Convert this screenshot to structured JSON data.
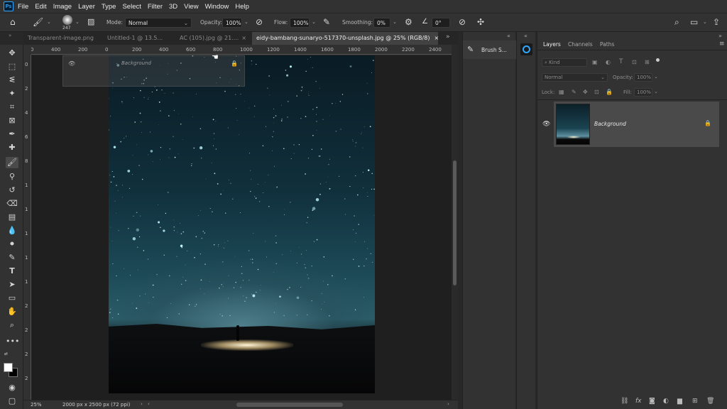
{
  "app": {
    "logo_text": "Ps"
  },
  "menu": [
    "File",
    "Edit",
    "Image",
    "Layer",
    "Type",
    "Select",
    "Filter",
    "3D",
    "View",
    "Window",
    "Help"
  ],
  "options_bar": {
    "brush_size": "247",
    "mode_label": "Mode:",
    "mode_value": "Normal",
    "opacity_label": "Opacity:",
    "opacity_value": "100%",
    "flow_label": "Flow:",
    "flow_value": "100%",
    "smoothing_label": "Smoothing:",
    "smoothing_value": "0%",
    "angle_value": "0°"
  },
  "tabs": [
    {
      "label": "Transparent-image.png",
      "active": false
    },
    {
      "label": "Untitled-1 @ 13.5...",
      "active": false
    },
    {
      "label": "AC (105).jpg @ 21....",
      "active": false
    },
    {
      "label": "eidy-bambang-sunaryo-517370-unsplash.jpg @ 25% (RGB/8)",
      "active": true
    }
  ],
  "ruler": {
    "h_labels": [
      "800",
      "400",
      "200",
      "0",
      "200",
      "400",
      "600",
      "800",
      "1000",
      "1200",
      "1400",
      "1600",
      "1800",
      "2000",
      "2200",
      "2400"
    ],
    "v_labels": [
      "0",
      "2",
      "4",
      "6",
      "8",
      "1",
      "1",
      "1",
      "1",
      "1",
      "2",
      "2",
      "2",
      "2"
    ]
  },
  "floating_doc": {
    "layer_name": "Background"
  },
  "status": {
    "zoom": "25%",
    "doc_size": "2000 px x 2500 px (72 ppi)"
  },
  "dock1": {
    "panel_label": "Brush S..."
  },
  "layers_panel": {
    "tabs": [
      "Layers",
      "Channels",
      "Paths"
    ],
    "filter_placeholder": "Kind",
    "blend_mode": "Normal",
    "opacity_label": "Opacity:",
    "opacity_value": "100%",
    "lock_label": "Lock:",
    "fill_label": "Fill:",
    "fill_value": "100%",
    "layer_name": "Background"
  },
  "colors": {
    "accent": "#31a8ff",
    "panel_bg": "#323232",
    "canvas_bg": "#1f1f1f"
  }
}
